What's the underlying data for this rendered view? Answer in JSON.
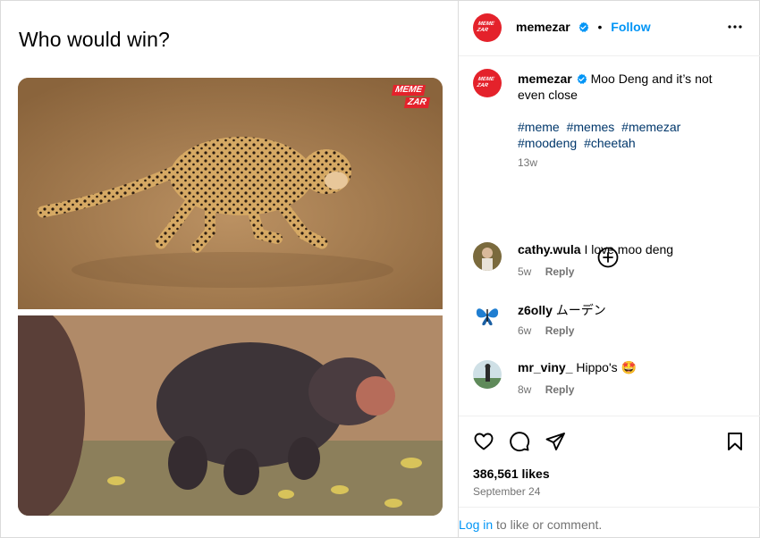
{
  "post": {
    "caption_title": "Who would win?",
    "watermark": [
      "MEME",
      "ZAR"
    ]
  },
  "header": {
    "username": "memezar",
    "separator": "•",
    "follow_label": "Follow"
  },
  "caption": {
    "username": "memezar",
    "text": "Moo Deng and it’s not even close",
    "hashtags": [
      "#meme",
      "#memes",
      "#memezar",
      "#moodeng",
      "#cheetah"
    ],
    "time": "13w"
  },
  "comments": [
    {
      "username": "cathy.wula",
      "text": "I love moo deng",
      "time": "5w",
      "reply": "Reply"
    },
    {
      "username": "z6olly",
      "text": "ムーデン",
      "time": "6w",
      "reply": "Reply"
    },
    {
      "username": "mr_viny_",
      "text": "Hippo's 🤩",
      "time": "8w",
      "reply": "Reply"
    }
  ],
  "footer": {
    "likes": "386,561 likes",
    "date": "September 24",
    "login_link": "Log in",
    "login_rest": " to like or comment."
  },
  "colors": {
    "accent": "#0095f6",
    "brand": "#e4222b",
    "hashtag": "#00376b",
    "muted": "#737373"
  },
  "icons": [
    "verified-icon",
    "more-icon",
    "add-comment-icon",
    "heart-icon",
    "comment-icon",
    "share-icon",
    "bookmark-icon"
  ]
}
